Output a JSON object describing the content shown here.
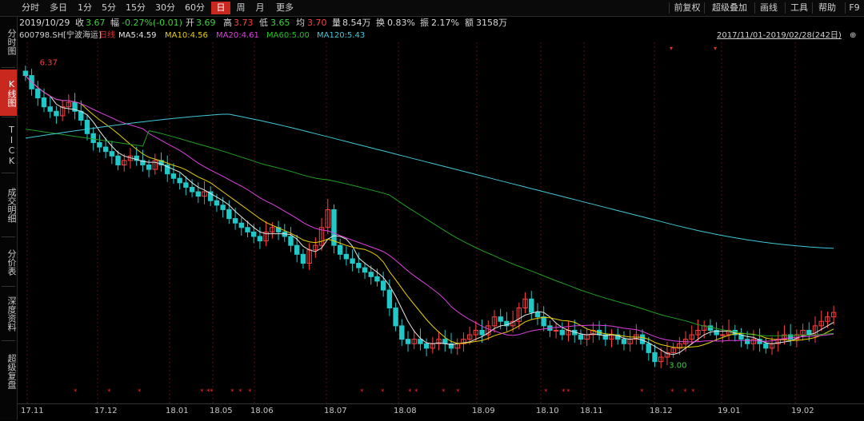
{
  "toolbar": {
    "periods": [
      "分时",
      "多日",
      "1分",
      "5分",
      "15分",
      "30分",
      "60分",
      "日",
      "周",
      "月",
      "更多"
    ],
    "active_period": "日",
    "right": [
      "前复权",
      "超级叠加",
      "画线",
      "工具",
      "帮助",
      "F9"
    ]
  },
  "info": {
    "date": "2019/10/29",
    "close_label": "收",
    "close": "3.67",
    "change_label": "幅",
    "change": "-0.27%(-0.01)",
    "open_label": "开",
    "open": "3.69",
    "high_label": "高",
    "high": "3.73",
    "low_label": "低",
    "low": "3.65",
    "avg_label": "均",
    "avg": "3.70",
    "vol_label": "量",
    "vol": "8.54万",
    "turn_label": "换",
    "turn": "0.83%",
    "amp_label": "振",
    "amp": "2.17%",
    "amt_label": "额",
    "amt": "3158万"
  },
  "ma": {
    "code": "600798.SH",
    "name": "[宁波海运]",
    "kline": "日线",
    "ma5": "MA5:4.59",
    "ma10": "MA10:4.56",
    "ma20": "MA20:4.61",
    "ma60": "MA60:5.00",
    "ma120": "MA120:5.43",
    "range": "2017/11/01-2019/02/28(242日)"
  },
  "sidebar": [
    "分时图",
    "K线图",
    "TICK",
    "成交明细",
    "分价表",
    "深度资料",
    "超级复盘"
  ],
  "annotations": {
    "high": "6.37",
    "low": "3.00"
  },
  "colors": {
    "up": "#ff4040",
    "down": "#3fd03f",
    "ma5": "#e6e6e6",
    "ma10": "#e8d000",
    "ma20": "#e040e0",
    "ma60": "#20a020",
    "ma120": "#40c8d8",
    "grid": "#5a1010"
  },
  "chart_data": {
    "type": "candlestick",
    "x_ticks": [
      "17.11",
      "17.12",
      "18.01",
      "18.05",
      "18.06",
      "18.07",
      "18.08",
      "18.09",
      "18.10",
      "18.11",
      "18.12",
      "19.01",
      "19.02"
    ],
    "ylim": [
      2.8,
      6.5
    ],
    "closes": [
      6.2,
      6.05,
      5.95,
      5.85,
      5.8,
      5.75,
      5.85,
      5.9,
      5.8,
      5.7,
      5.55,
      5.45,
      5.4,
      5.35,
      5.3,
      5.2,
      5.25,
      5.3,
      5.25,
      5.2,
      5.15,
      5.25,
      5.2,
      5.1,
      5.05,
      5.0,
      4.95,
      4.9,
      4.85,
      4.9,
      4.8,
      4.75,
      4.7,
      4.6,
      4.55,
      4.5,
      4.45,
      4.4,
      4.35,
      4.45,
      4.5,
      4.45,
      4.4,
      4.3,
      4.2,
      4.1,
      4.25,
      4.3,
      4.5,
      4.7,
      4.3,
      4.2,
      4.15,
      4.1,
      4.05,
      4.0,
      3.95,
      3.9,
      3.8,
      3.6,
      3.4,
      3.25,
      3.2,
      3.25,
      3.2,
      3.15,
      3.2,
      3.25,
      3.2,
      3.15,
      3.2,
      3.25,
      3.3,
      3.35,
      3.3,
      3.4,
      3.5,
      3.45,
      3.4,
      3.45,
      3.6,
      3.7,
      3.55,
      3.5,
      3.4,
      3.35,
      3.35,
      3.3,
      3.35,
      3.3,
      3.25,
      3.3,
      3.35,
      3.3,
      3.25,
      3.3,
      3.25,
      3.2,
      3.25,
      3.3,
      3.2,
      3.1,
      3.0,
      3.05,
      3.1,
      3.15,
      3.2,
      3.25,
      3.3,
      3.35,
      3.4,
      3.35,
      3.3,
      3.3,
      3.35,
      3.3,
      3.25,
      3.2,
      3.25,
      3.2,
      3.15,
      3.2,
      3.25,
      3.3,
      3.25,
      3.3,
      3.35,
      3.3,
      3.4,
      3.45,
      3.5,
      3.55
    ]
  }
}
